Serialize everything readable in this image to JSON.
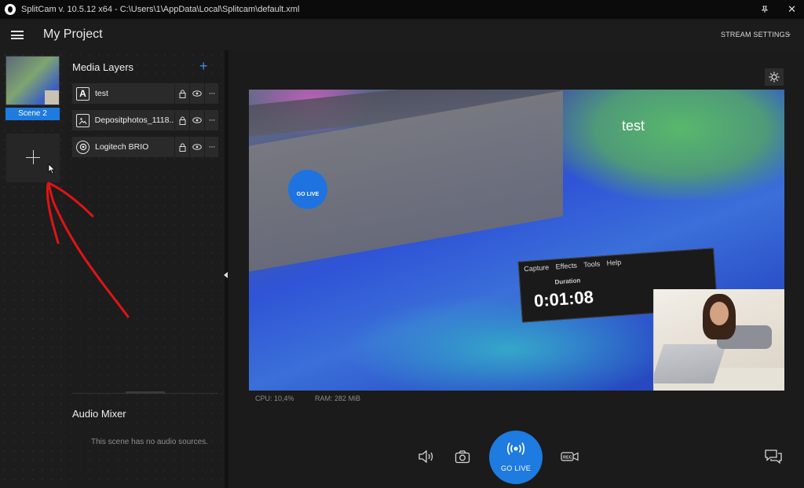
{
  "window": {
    "title": "SplitCam v. 10.5.12 x64 - C:\\Users\\1\\AppData\\Local\\Splitcam\\default.xml",
    "pin_icon": "pin-icon",
    "close_glyph": "✕"
  },
  "header": {
    "project_title": "My Project",
    "stream_settings_label": "STREAM SETTINGS",
    "chevron": "⌄"
  },
  "scenes": {
    "items": [
      {
        "label": "Scene 2",
        "selected": true
      }
    ],
    "add_glyph": "+"
  },
  "layers": {
    "title": "Media Layers",
    "add_glyph": "+",
    "items": [
      {
        "name": "test",
        "type": "text-icon",
        "type_glyph": "A"
      },
      {
        "name": "Depositphotos_1118...",
        "type": "image-icon",
        "type_glyph": "▣"
      },
      {
        "name": "Logitech BRIO",
        "type": "webcam-icon",
        "type_glyph": "◎"
      }
    ],
    "lock_glyph": "🔒",
    "eye_glyph": "👁",
    "more_glyph": "···"
  },
  "audio": {
    "title": "Audio Mixer",
    "empty_message": "This scene has no audio sources."
  },
  "preview": {
    "overlay_text": "test",
    "embedded": {
      "menu": "Capture Effects Tools Help",
      "duration_label": "Duration",
      "time": "0:01:08",
      "go_live": "GO LIVE"
    }
  },
  "stats": {
    "cpu": "CPU: 10,4%",
    "ram": "RAM: 282 MiB"
  },
  "bottom": {
    "go_live_label": "GO LIVE",
    "speaker_glyph": "🔈",
    "camera_glyph": "📷",
    "rec_glyph": "REC",
    "chat_glyph": "💬"
  },
  "colors": {
    "accent": "#1e7be0",
    "annotation_arrow": "#e01414"
  }
}
